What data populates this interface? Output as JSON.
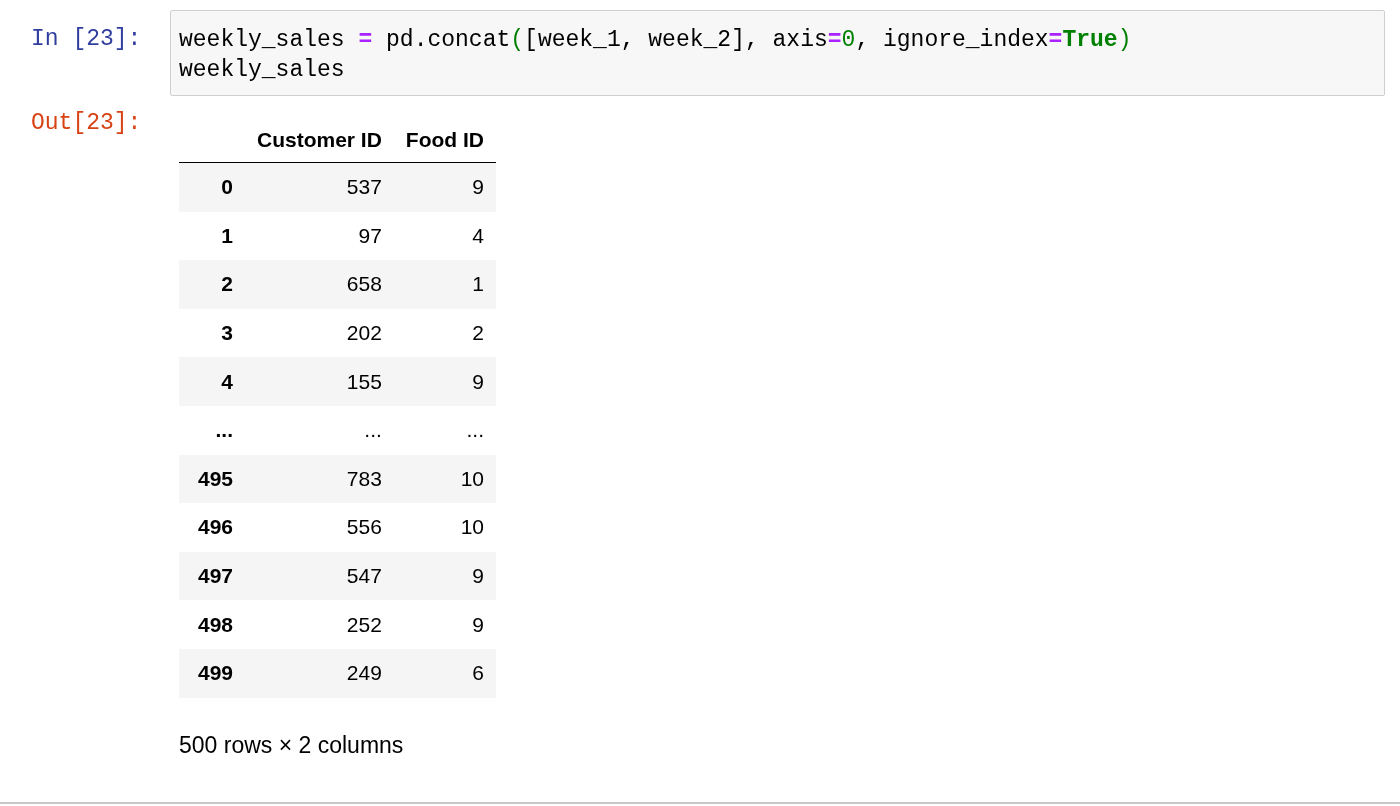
{
  "input_prompt": "In [23]:",
  "code_lines": [
    [
      {
        "kind": "name",
        "text": "weekly_sales "
      },
      {
        "kind": "operator",
        "text": "="
      },
      {
        "kind": "name",
        "text": " pd.concat"
      },
      {
        "kind": "paren",
        "text": "("
      },
      {
        "kind": "name",
        "text": "[week_1, week_2], axis"
      },
      {
        "kind": "operator",
        "text": "="
      },
      {
        "kind": "number",
        "text": "0"
      },
      {
        "kind": "name",
        "text": ", ignore_index"
      },
      {
        "kind": "operator",
        "text": "="
      },
      {
        "kind": "keyword",
        "text": "True"
      },
      {
        "kind": "paren",
        "text": ")"
      }
    ],
    [
      {
        "kind": "name",
        "text": "weekly_sales"
      }
    ]
  ],
  "output_prompt": "Out[23]:",
  "table": {
    "columns": [
      "",
      "Customer ID",
      "Food ID"
    ],
    "rows": [
      [
        "0",
        "537",
        "9"
      ],
      [
        "1",
        "97",
        "4"
      ],
      [
        "2",
        "658",
        "1"
      ],
      [
        "3",
        "202",
        "2"
      ],
      [
        "4",
        "155",
        "9"
      ],
      [
        "...",
        "...",
        "..."
      ],
      [
        "495",
        "783",
        "10"
      ],
      [
        "496",
        "556",
        "10"
      ],
      [
        "497",
        "547",
        "9"
      ],
      [
        "498",
        "252",
        "9"
      ],
      [
        "499",
        "249",
        "6"
      ]
    ]
  },
  "summary": "500 rows × 2 columns"
}
